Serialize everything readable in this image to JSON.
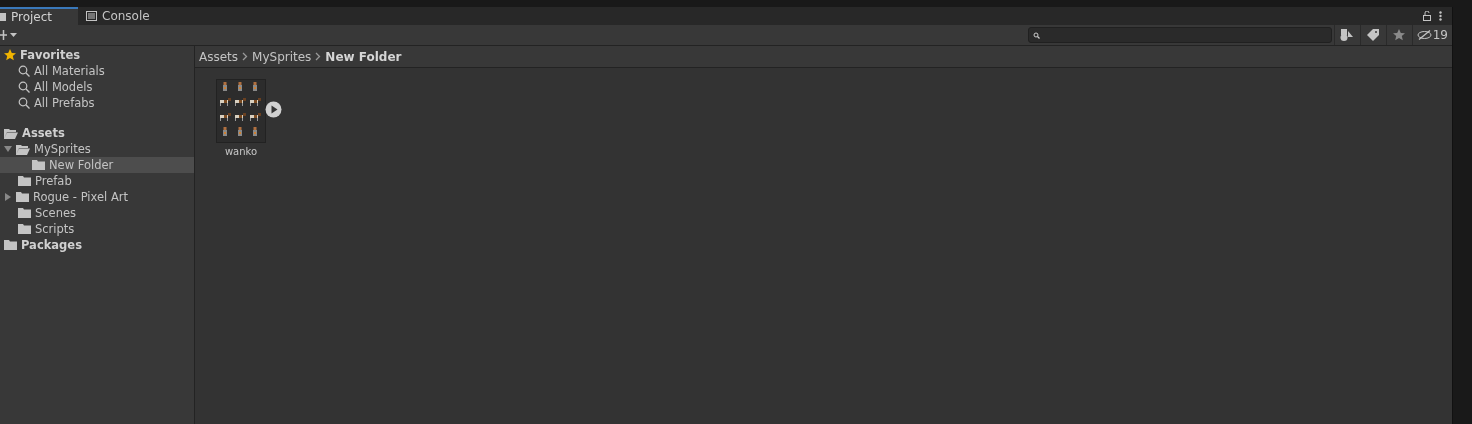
{
  "tabs": [
    {
      "label": "Project",
      "kind": "folder",
      "selected": true
    },
    {
      "label": "Console",
      "kind": "console",
      "selected": false
    }
  ],
  "toolbar": {
    "hidden_count": "19"
  },
  "tree": [
    {
      "label": "Favorites",
      "kind": "favorites",
      "selected": false,
      "children": [
        {
          "label": "All Materials",
          "kind": "search",
          "selected": false
        },
        {
          "label": "All Models",
          "kind": "search",
          "selected": false
        },
        {
          "label": "All Prefabs",
          "kind": "search",
          "selected": false
        }
      ]
    },
    {
      "label": "Assets",
      "kind": "open-folder",
      "selected": false,
      "children": [
        {
          "label": "MySprites",
          "kind": "open-folder",
          "expanded": true,
          "selected": false,
          "children": [
            {
              "label": "New Folder",
              "kind": "folder",
              "selected": true
            }
          ]
        },
        {
          "label": "Prefab",
          "kind": "folder",
          "selected": false
        },
        {
          "label": "Rogue - Pixel Art",
          "kind": "folder",
          "expanded": false,
          "selected": false
        },
        {
          "label": "Scenes",
          "kind": "folder",
          "selected": false
        },
        {
          "label": "Scripts",
          "kind": "folder",
          "selected": false
        }
      ]
    },
    {
      "label": "Packages",
      "kind": "folder",
      "selected": false
    }
  ],
  "breadcrumb": [
    "Assets",
    "MySprites",
    "New Folder"
  ],
  "assets": [
    {
      "name": "wanko"
    }
  ]
}
